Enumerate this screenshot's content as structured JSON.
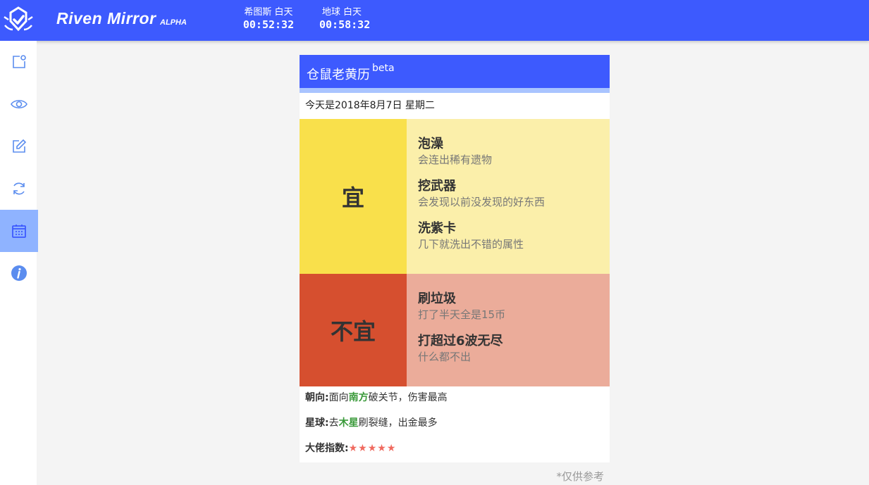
{
  "app": {
    "title": "Riven Mirror",
    "subtitle": "ALPHA",
    "brand_color": "#3d5afe"
  },
  "timers": [
    {
      "label": "希图斯 白天",
      "value": "00:52:32"
    },
    {
      "label": "地球 白天",
      "value": "00:58:32"
    }
  ],
  "sidebar": {
    "items": [
      {
        "icon": "share-window-icon",
        "active": false
      },
      {
        "icon": "eye-icon",
        "active": false
      },
      {
        "icon": "edit-icon",
        "active": false
      },
      {
        "icon": "refresh-icon",
        "active": false
      },
      {
        "icon": "calendar-icon",
        "active": true
      },
      {
        "icon": "info-icon",
        "active": false
      }
    ]
  },
  "almanac": {
    "title": "仓鼠老黄历",
    "title_badge": "beta",
    "date_text": "今天是2018年8月7日 星期二",
    "good": {
      "label": "宜",
      "color": "#f9e04b",
      "items": [
        {
          "title": "泡澡",
          "desc": "会连出稀有遗物"
        },
        {
          "title": "挖武器",
          "desc": "会发现以前没发现的好东西"
        },
        {
          "title": "洗紫卡",
          "desc": "几下就洗出不错的属性"
        }
      ]
    },
    "bad": {
      "label": "不宜",
      "color": "#d64f2f",
      "items": [
        {
          "title": "刷垃圾",
          "desc": "打了半天全是15币"
        },
        {
          "title": "打超过6波无尽",
          "desc": "什么都不出"
        }
      ]
    },
    "direction": {
      "label": "朝向:",
      "pre": "面向",
      "highlight": "南方",
      "post": "破关节，伤害最高"
    },
    "planet": {
      "label": "星球:",
      "pre": "去",
      "highlight": "木星",
      "post": "刷裂缝，出金最多"
    },
    "boss_index": {
      "label": "大佬指数:",
      "stars": "★★★★★",
      "rating": 5
    },
    "note": "*仅供参考"
  }
}
